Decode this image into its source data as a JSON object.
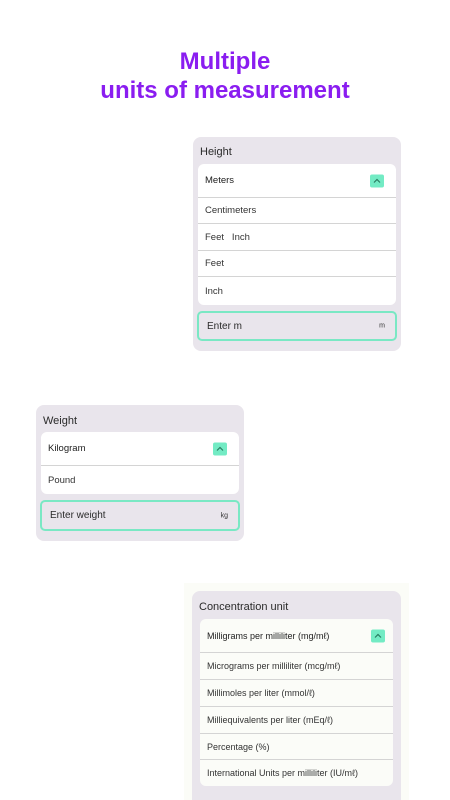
{
  "headline": {
    "line1": "Multiple",
    "line2": "units of measurement"
  },
  "colors": {
    "accent": "#8a1df0",
    "highlight": "#73ebc4",
    "card": "#e9e5ec"
  },
  "height": {
    "title": "Height",
    "selected": "Meters",
    "options": [
      "Centimeters",
      "Feet   Inch",
      "Feet",
      "Inch"
    ],
    "input_placeholder": "Enter m",
    "input_unit": "m"
  },
  "weight": {
    "title": "Weight",
    "selected": "Kilogram",
    "options": [
      "Pound"
    ],
    "input_placeholder": "Enter weight",
    "input_unit": "kg"
  },
  "concentration": {
    "title": "Concentration unit",
    "selected": "Milligrams per milliliter (mg/mℓ)",
    "options": [
      "Micrograms per milliliter (mcg/mℓ)",
      "Millimoles per liter (mmol/ℓ)",
      "Milliequivalents per liter (mEq/ℓ)",
      "Percentage (%)",
      "International Units per milliliter (IU/mℓ)"
    ]
  },
  "icons": {
    "dropdown": "chevron-up-icon"
  }
}
